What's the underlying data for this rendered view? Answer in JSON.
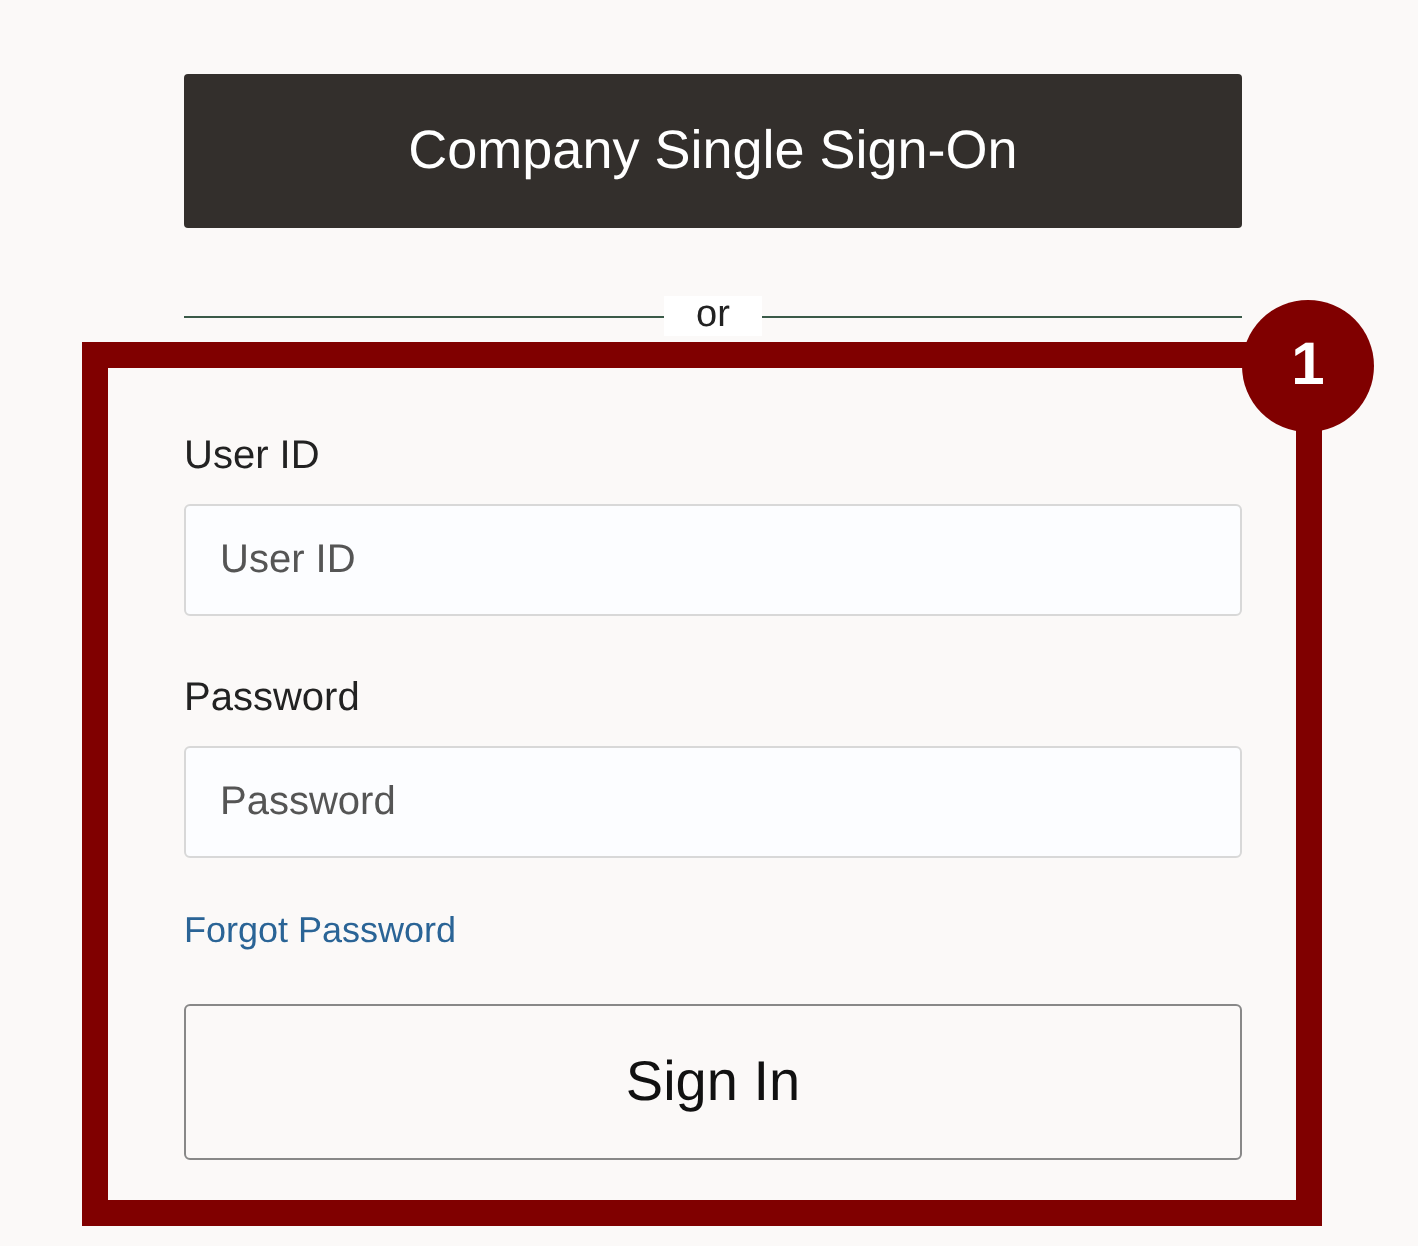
{
  "sso_button": {
    "label": "Company Single Sign-On"
  },
  "divider": {
    "label": "or"
  },
  "fields": [
    {
      "label": "User ID",
      "placeholder": "User ID"
    },
    {
      "label": "Password",
      "placeholder": "Password"
    }
  ],
  "forgot_link": {
    "label": "Forgot Password"
  },
  "sign_in_button": {
    "label": "Sign In"
  },
  "annotation": {
    "number": "1"
  }
}
